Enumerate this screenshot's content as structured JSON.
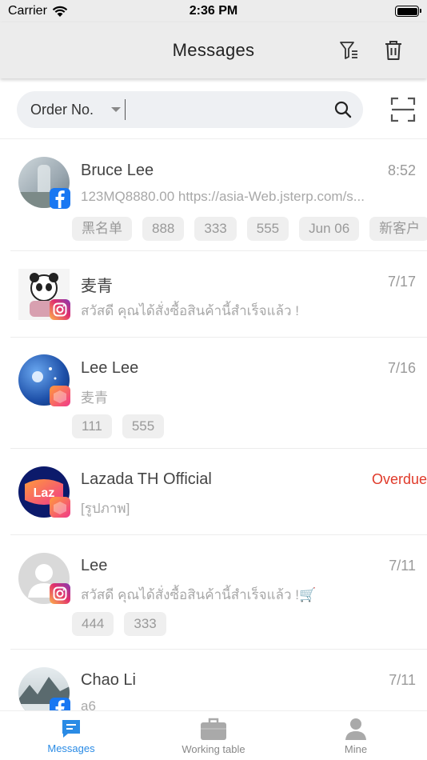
{
  "status_bar": {
    "carrier": "Carrier",
    "time": "2:36 PM"
  },
  "nav": {
    "title": "Messages",
    "icons": [
      "filter-icon",
      "trash-icon"
    ]
  },
  "search": {
    "select_label": "Order No.",
    "input_value": "",
    "icons": [
      "search-icon",
      "scan-icon"
    ]
  },
  "messages": [
    {
      "name": "Bruce Lee",
      "time": "8:52",
      "preview": "123MQ8880.00 https://asia-Web.jsterp.com/s...",
      "platform": "facebook",
      "tags": [
        "黑名单",
        "888",
        "333",
        "555",
        "Jun 06",
        "新客户"
      ]
    },
    {
      "name": "麦青",
      "time": "7/17",
      "preview": "สวัสดี คุณได้สั่งซื้อสินค้านี้สำเร็จแล้ว !",
      "platform": "instagram",
      "tags": []
    },
    {
      "name": "Lee Lee",
      "time": "7/16",
      "preview": "麦青",
      "platform": "lazada",
      "tags": [
        "111",
        "555"
      ]
    },
    {
      "name": "Lazada TH Official",
      "time": "Overdue",
      "preview": "[รูปภาพ]",
      "platform": "lazada",
      "tags": []
    },
    {
      "name": "Lee",
      "time": "7/11",
      "preview": "สวัสดี คุณได้สั่งซื้อสินค้านี้สำเร็จแล้ว !🛒",
      "platform": "instagram",
      "tags": [
        "444",
        "333"
      ]
    },
    {
      "name": "Chao Li",
      "time": "7/11",
      "preview": "a6",
      "platform": "facebook",
      "tags": []
    }
  ],
  "tab_bar": {
    "tabs": [
      {
        "label": "Messages",
        "icon": "chat-icon",
        "active": true
      },
      {
        "label": "Working table",
        "icon": "briefcase-icon",
        "active": false
      },
      {
        "label": "Mine",
        "icon": "person-icon",
        "active": false
      }
    ]
  },
  "colors": {
    "accent": "#2a8be5",
    "overdue": "#e03a2a",
    "facebook": "#1877f2",
    "lazada": "#f0398a"
  }
}
